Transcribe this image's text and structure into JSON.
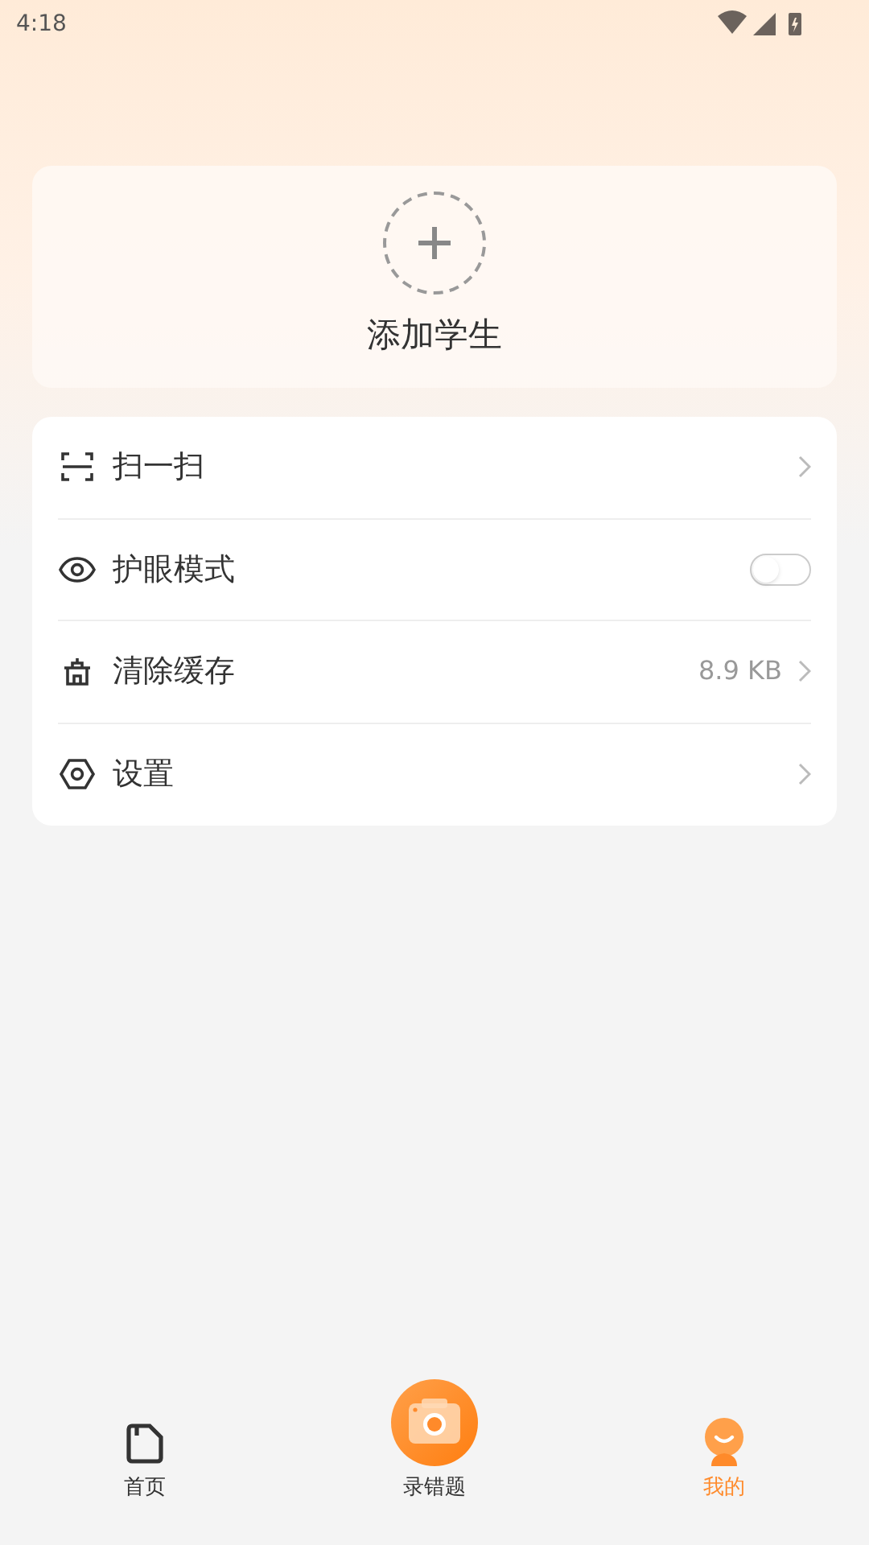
{
  "status_bar": {
    "time": "4:18"
  },
  "add_student": {
    "label": "添加学生"
  },
  "menu": [
    {
      "kind": "link",
      "label": "扫一扫"
    },
    {
      "kind": "toggle",
      "label": "护眼模式",
      "on": false
    },
    {
      "kind": "value",
      "label": "清除缓存",
      "value": "8.9 KB"
    },
    {
      "kind": "link",
      "label": "设置"
    }
  ],
  "tabs": [
    {
      "kind": "home",
      "label": "首页",
      "selected": false
    },
    {
      "kind": "camera",
      "label": "录错题",
      "selected": false
    },
    {
      "kind": "me",
      "label": "我的",
      "selected": true
    }
  ]
}
